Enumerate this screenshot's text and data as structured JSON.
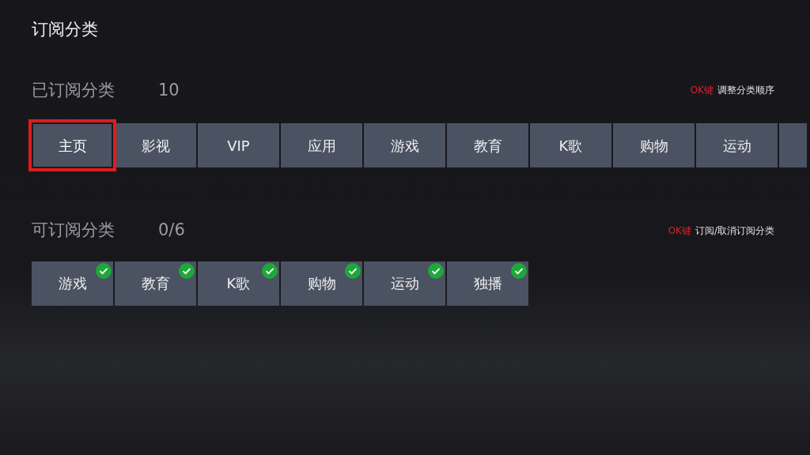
{
  "title": "订阅分类",
  "subscribed": {
    "heading": "已订阅分类",
    "count": "10",
    "hint_key": "OK键",
    "hint": "调整分类顺序",
    "items": [
      {
        "label": "主页",
        "selected": true
      },
      {
        "label": "影视",
        "selected": false
      },
      {
        "label": "VIP",
        "selected": false
      },
      {
        "label": "应用",
        "selected": false
      },
      {
        "label": "游戏",
        "selected": false
      },
      {
        "label": "教育",
        "selected": false
      },
      {
        "label": "K歌",
        "selected": false
      },
      {
        "label": "购物",
        "selected": false
      },
      {
        "label": "运动",
        "selected": false
      },
      {
        "selected": false
      }
    ]
  },
  "available": {
    "heading": "可订阅分类",
    "count": "0/6",
    "hint_key": "OK键",
    "hint": "订阅/取消订阅分类",
    "items": [
      {
        "label": "游戏",
        "checked": true
      },
      {
        "label": "教育",
        "checked": true
      },
      {
        "label": "K歌",
        "checked": true
      },
      {
        "label": "购物",
        "checked": true
      },
      {
        "label": "运动",
        "checked": true
      },
      {
        "label": "独播",
        "checked": true
      }
    ]
  }
}
